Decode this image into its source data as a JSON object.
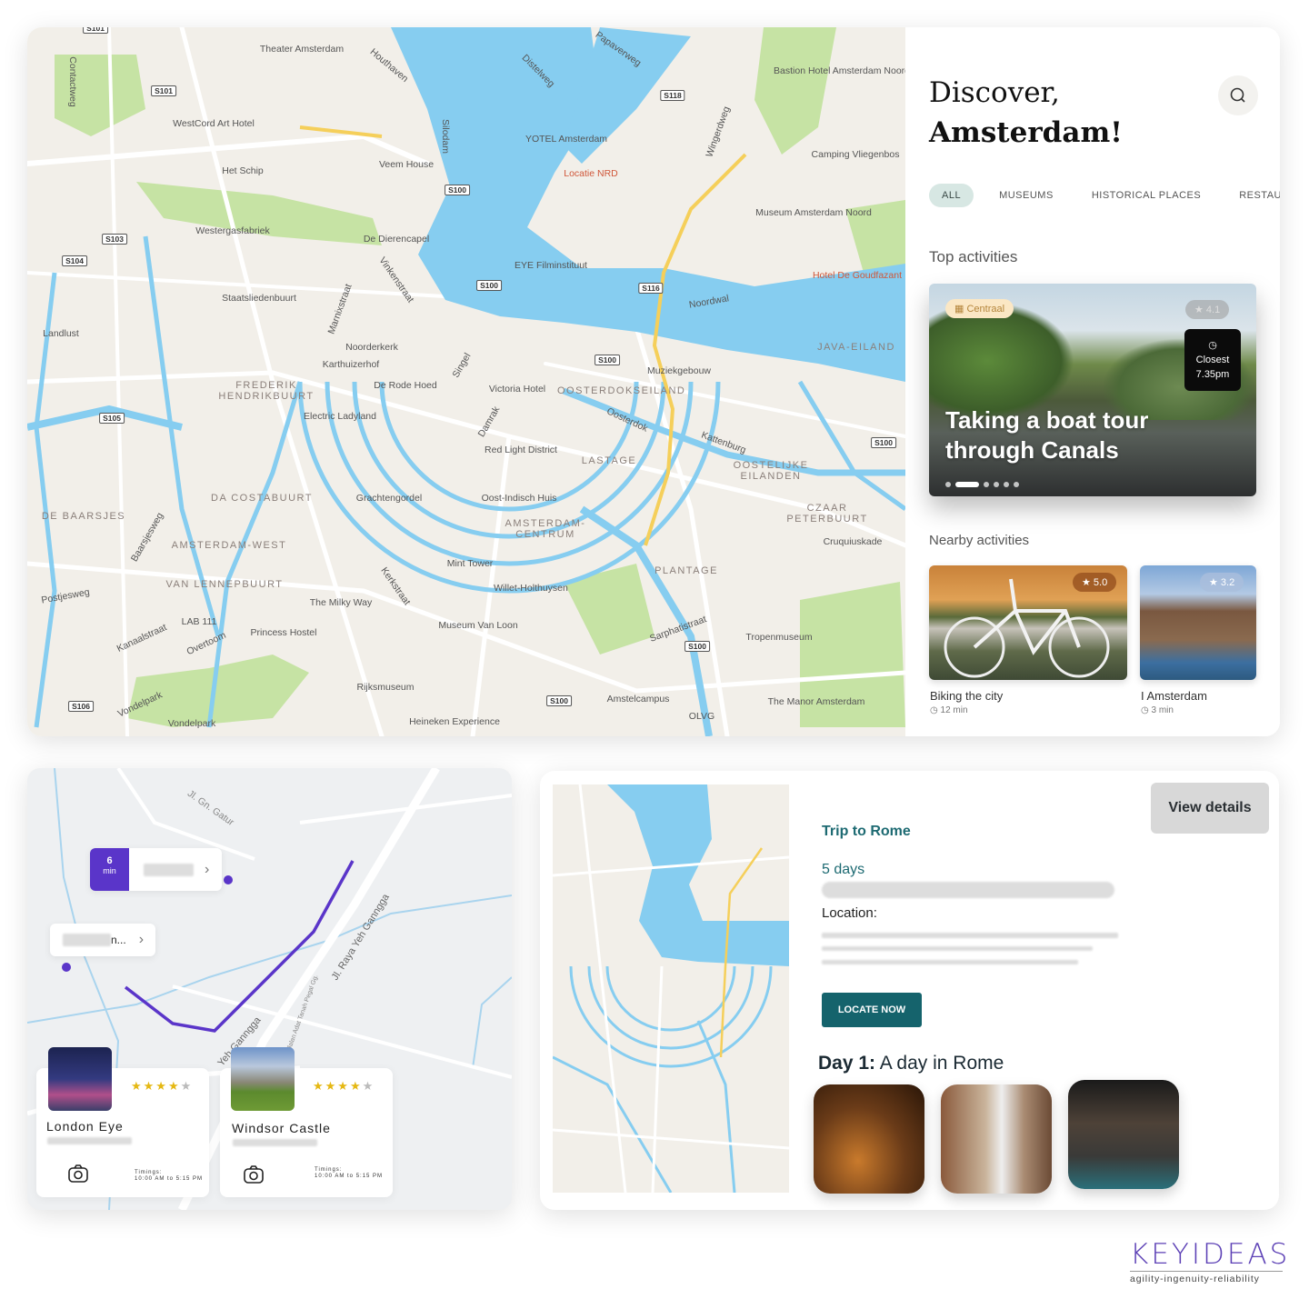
{
  "colors": {
    "water": "#86cdf0",
    "land": "#f2efe9",
    "park": "#c6e3a4",
    "route": "#5a35c9",
    "teal": "#15636c",
    "accent": "#5b3fb5"
  },
  "map": {
    "labels": [
      "Theater Amsterdam",
      "WestCord Art Hotel",
      "Het Schip",
      "Veem House",
      "YOTEL Amsterdam",
      "Locatie NRD",
      "Bastion Hotel Amsterdam Noord",
      "Camping Vliegenbos",
      "Museum Amsterdam Noord",
      "Westergasfabriek",
      "De Dierencapel",
      "EYE Filminstituut",
      "Hotel De Goudfazant",
      "Staatsliedenbuurt",
      "Landlust",
      "Noorderkerk",
      "Karthuizerhof",
      "De Rode Hoed",
      "Victoria Hotel",
      "Muziekgebouw",
      "Electric Ladyland",
      "Red Light District",
      "Oost-Indisch Huis",
      "Grachtengordel",
      "Mint Tower",
      "Willet-Holthuysen",
      "The Milky Way",
      "Museum Van Loon",
      "LAB 111",
      "Princess Hostel",
      "Rijksmuseum",
      "Heineken Experience",
      "Amstelcampus",
      "OLVG",
      "The Manor Amsterdam",
      "Tropenmuseum",
      "Vondelpark",
      "Cruquiuskade",
      "Noordwal",
      "Kattenburg",
      "Oosterdok",
      "Houthaven",
      "Papaverweg",
      "Distelweg",
      "Damrak",
      "Singel",
      "Vinkenstraat",
      "Marnixstraat",
      "Kerkstraat",
      "Sarphatistraat",
      "Overtoom",
      "Kanaalstraat",
      "Postjesweg",
      "Baarsjesweg",
      "Vondelpark",
      "Contactweg",
      "Silodam",
      "Wingerdweg"
    ],
    "districts": [
      "FREDERIK HENDRIKBUURT",
      "DA COSTABUURT",
      "DE BAARSJES",
      "AMSTERDAM-WEST",
      "VAN LENNEPBUURT",
      "AMSTERDAM-CENTRUM",
      "LASTAGE",
      "OOSTERDOKSEILAND",
      "OOSTELIJKE EILANDEN",
      "CZAAR PETERBUURT",
      "PLANTAGE",
      "JAVA-EILAND"
    ],
    "shields": [
      "S101",
      "S101",
      "S118",
      "S100",
      "S103",
      "S104",
      "S100",
      "S116",
      "S100",
      "S105",
      "S100",
      "S100",
      "S100",
      "S106"
    ]
  },
  "panel": {
    "title_line1": "Discover,",
    "title_line2": "Amsterdam!",
    "search_icon": "search-icon",
    "tabs": [
      {
        "label": "ALL",
        "active": true
      },
      {
        "label": "MUSEUMS"
      },
      {
        "label": "HISTORICAL PLACES"
      },
      {
        "label": "RESTAURAN"
      }
    ],
    "top_heading": "Top activities",
    "top": {
      "tag": "Centraal",
      "rating": "4.1",
      "closest_label": "Closest",
      "closest_time": "7.35pm",
      "title_line1": "Taking a boat tour",
      "title_line2": "through Canals",
      "slides": 6,
      "active_slide": 2
    },
    "nearby_heading": "Nearby activities",
    "nearby": [
      {
        "title": "Biking the city",
        "time": "12 min",
        "rating": "5.0"
      },
      {
        "title": "I Amsterdam",
        "time": "3 min",
        "rating": "3.2"
      }
    ]
  },
  "route_card": {
    "eta_value": "6",
    "eta_unit": "min",
    "callout2_suffix": "n...",
    "streets": [
      "Jl. Raya Yeh Ganngga",
      "Yeh Ganngga",
      "Jl. Gn. Gatur",
      "Jalan Adat Tanah Pegal Gg."
    ],
    "places": [
      {
        "name": "London Eye",
        "stars": 4,
        "timing_label": "Timings:",
        "timing": "10:00 AM to 5:15 PM"
      },
      {
        "name": "Windsor Castle",
        "stars": 4,
        "timing_label": "Timings:",
        "timing": "10:00 AM to 5:15 PM"
      }
    ]
  },
  "trip": {
    "view_details": "View details",
    "title": "Trip to Rome",
    "duration": "5 days",
    "location_label": "Location:",
    "locate_button": "LOCATE NOW",
    "day_label": "Day 1:",
    "day_title": "A day in Rome"
  },
  "brand": {
    "name": "KEYIDEAS",
    "tagline": "agility-ingenuity-reliability"
  }
}
